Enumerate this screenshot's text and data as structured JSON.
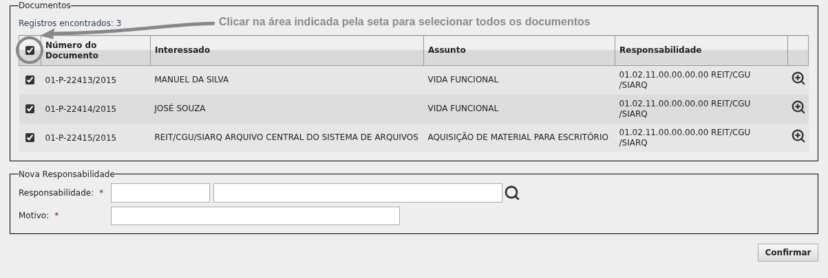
{
  "documents": {
    "legend": "Documentos",
    "count_text": "Registros encontrados: 3",
    "hint": "Clicar na área indicada pela seta para selecionar todos os documentos",
    "select_all": {
      "checked": true
    },
    "columns": [
      "Número do Documento",
      "Interessado",
      "Assunto",
      "Responsabilidade"
    ],
    "rows": [
      {
        "selected": true,
        "numero": "01-P-22413/2015",
        "interessado": "MANUEL DA SILVA",
        "assunto": "VIDA FUNCIONAL",
        "responsabilidade": "01.02.11.00.00.00.00 REIT/CGU /SIARQ"
      },
      {
        "selected": true,
        "numero": "01-P-22414/2015",
        "interessado": "JOSÉ SOUZA",
        "assunto": "VIDA FUNCIONAL",
        "responsabilidade": "01.02.11.00.00.00.00 REIT/CGU /SIARQ"
      },
      {
        "selected": true,
        "numero": "01-P-22415/2015",
        "interessado": "REIT/CGU/SIARQ ARQUIVO CENTRAL DO SISTEMA DE ARQUIVOS",
        "assunto": "AQUISIÇÃO DE MATERIAL PARA ESCRITÓRIO",
        "responsabilidade": "01.02.11.00.00.00.00 REIT/CGU /SIARQ"
      }
    ]
  },
  "nova_responsabilidade": {
    "legend": "Nova Responsabilidade",
    "fields": [
      {
        "kind": "lookup",
        "label": "Responsabilidade:",
        "required": "*"
      },
      {
        "kind": "text",
        "label": "Motivo:",
        "required": "*"
      }
    ]
  },
  "confirm_button": "Confirmar"
}
